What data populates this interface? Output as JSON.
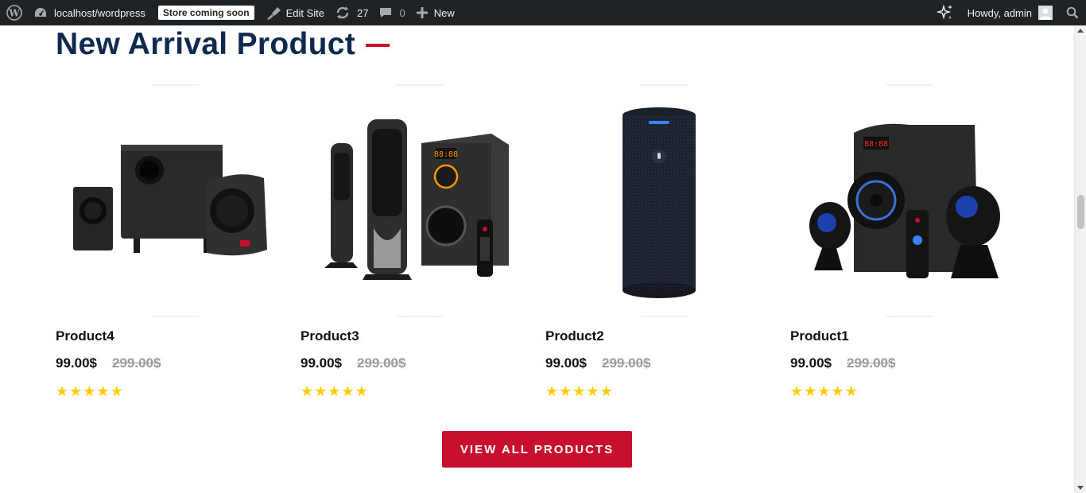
{
  "adminbar": {
    "site_name": "localhost/wordpress",
    "store_badge": "Store coming soon",
    "edit_site": "Edit Site",
    "updates_count": "27",
    "comments_count": "0",
    "new_label": "New",
    "howdy": "Howdy, admin"
  },
  "section": {
    "title": "New Arrival Product"
  },
  "products": [
    {
      "name": "Product4",
      "price": "99.00$",
      "old_price": "299.00$",
      "rating": 5
    },
    {
      "name": "Product3",
      "price": "99.00$",
      "old_price": "299.00$",
      "rating": 5
    },
    {
      "name": "Product2",
      "price": "99.00$",
      "old_price": "299.00$",
      "rating": 5
    },
    {
      "name": "Product1",
      "price": "99.00$",
      "old_price": "299.00$",
      "rating": 5
    }
  ],
  "cta": {
    "view_all": "VIEW ALL PRODUCTS"
  },
  "colors": {
    "accent": "#c8102e",
    "title": "#0f2a4e",
    "star": "#ffcc00",
    "adminbar": "#1d2327"
  }
}
